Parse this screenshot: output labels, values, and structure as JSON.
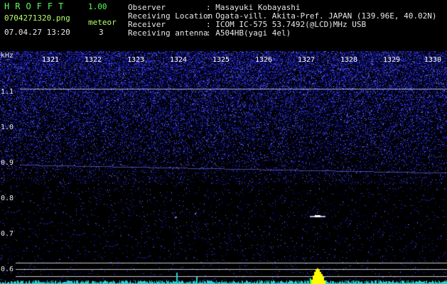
{
  "header": {
    "app_name": "HROFFT",
    "version": "1.00",
    "filename": "0704271320.png",
    "datetime": "07.04.27 13:20",
    "meteor_label": "meteor",
    "meteor_count": "3",
    "info": [
      {
        "label": "Observer",
        "value": ": Masayuki Kobayashi"
      },
      {
        "label": "Receiving Location",
        "value": ": Ogata-vill. Akita-Pref. JAPAN (139.96E, 40.02N)"
      },
      {
        "label": "Receiver",
        "value": ": ICOM IC-575 53.7492(@LCD)MHz USB"
      },
      {
        "label": "Receiving antenna",
        "value": ": A504HB(yagi 4el)"
      }
    ]
  },
  "spectrogram": {
    "unit_label": "kHz",
    "time_ticks": [
      "1321",
      "1322",
      "1323",
      "1324",
      "1325",
      "1326",
      "1327",
      "1328",
      "1329",
      "1330"
    ],
    "freq_ticks": [
      "1.1",
      "1.0",
      "0.9",
      "0.8",
      "0.7",
      "0.6"
    ],
    "colors": {
      "noise": "#1a22c8",
      "signal": "#ffffff",
      "meteor": "#ffff00",
      "spectrum": "#33d7d7",
      "lines": "#d0d0d0"
    }
  }
}
